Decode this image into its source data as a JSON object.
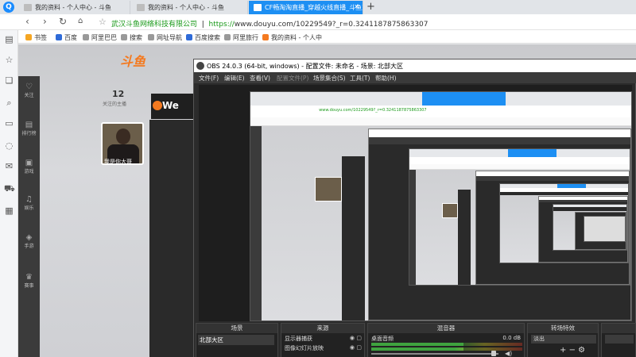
{
  "browser": {
    "tabs": [
      {
        "label": "我的资料 - 个人中心 - 斗鱼",
        "active": false
      },
      {
        "label": "我的资料 - 个人中心 - 斗鱼",
        "active": false
      },
      {
        "label": "CF畅淘淘直播_穿越火线直播_斗鱼直播",
        "active": true
      }
    ],
    "new_tab": "+",
    "address": {
      "org": "武汉斗鱼网络科技有限公司",
      "https": "https://",
      "url_rest": "www.douyu.com/10229549?_r=0.3241187875863307"
    },
    "bookmarks": [
      "书签",
      "百度",
      "阿里巴巴",
      "搜索",
      "网址导航",
      "百度搜索",
      "阿里旅行",
      "我的资料 - 个人中"
    ]
  },
  "page": {
    "brand": "斗鱼",
    "stat_number": "12",
    "stat_label": "关注的主播",
    "badge_text": "We",
    "rail": [
      "关注",
      "排行榜",
      "游戏",
      "娱乐",
      "手游",
      "赛事"
    ],
    "avatar_caption": "我是你大哥"
  },
  "obs": {
    "title": "OBS 24.0.3 (64-bit, windows) - 配置文件: 未命名 - 场景: 北部大区",
    "menu": [
      {
        "label": "文件(F)",
        "enabled": true
      },
      {
        "label": "编辑(E)",
        "enabled": true
      },
      {
        "label": "查看(V)",
        "enabled": true
      },
      {
        "label": "配置文件(P)",
        "enabled": false
      },
      {
        "label": "场景集合(S)",
        "enabled": true
      },
      {
        "label": "工具(T)",
        "enabled": true
      },
      {
        "label": "帮助(H)",
        "enabled": true
      }
    ],
    "docks": {
      "scenes": {
        "title": "场景",
        "items": [
          "北部大区"
        ]
      },
      "sources": {
        "title": "来源",
        "items": [
          "显示器捕获",
          "图像幻灯片放映"
        ]
      },
      "mixer": {
        "title": "混音器",
        "channel": "桌面音频",
        "db": "0.0 dB"
      },
      "transitions": {
        "title": "转场特效",
        "selected": "淡出"
      }
    }
  },
  "colors": {
    "accent": "#1d8ff3",
    "douyu_orange": "#f47a20",
    "obs_bg": "#2b2b2b"
  }
}
